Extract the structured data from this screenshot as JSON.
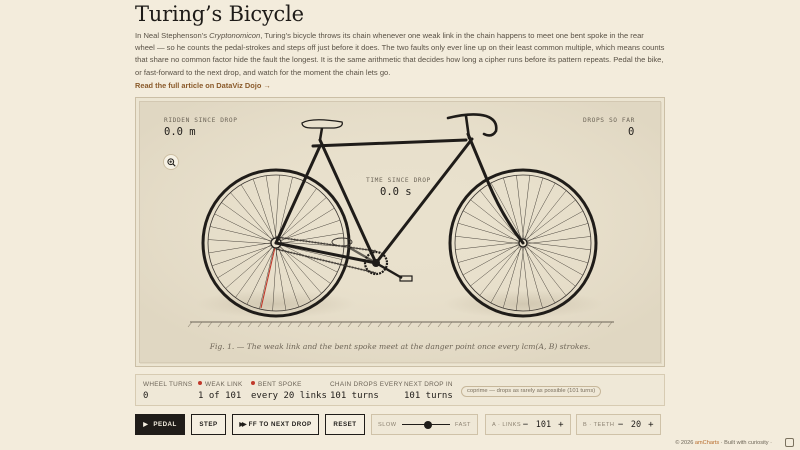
{
  "page": {
    "title": "Turing’s Bicycle",
    "intro_pre": "In Neal Stephenson’s ",
    "intro_em": "Cryptonomicon",
    "intro_post": ", Turing’s bicycle throws its chain whenever one weak link in the chain happens to meet one bent spoke in the rear wheel — so he counts the pedal-strokes and steps off just before it does. The two faults only ever line up on their least common multiple, which means counts that share no common factor hide the fault the longest. It is the same arithmetic that decides how long a cipher runs before its pattern repeats. Pedal the bike, or fast-forward to the next drop, and watch for the moment the chain lets go.",
    "read_more": "Read the full article on DataViz Dojo →"
  },
  "figure": {
    "ridden_label": "RIDDEN SINCE DROP",
    "ridden_value": "0.0 m",
    "drops_label": "DROPS SO FAR",
    "drops_value": "0",
    "time_label": "TIME SINCE DROP",
    "time_value": "0.0 s",
    "zoom_icon": "zoom-in-icon",
    "caption": "Fig. 1. — The weak link and the bent spoke meet at the danger point once every lcm(A, B) strokes.",
    "colors": {
      "frame": "#1f1c19",
      "bent_spoke": "#c0392b",
      "chain": "#3a3530"
    }
  },
  "stats": {
    "wheel_turns_label": "WHEEL TURNS",
    "wheel_turns_value": "0",
    "weak_link_label": "WEAK LINK",
    "weak_link_value": "1 of 101",
    "bent_spoke_label": "BENT SPOKE",
    "bent_spoke_value": "every 20 links",
    "chain_drops_label": "CHAIN DROPS EVERY",
    "chain_drops_value": "101 turns",
    "next_drop_label": "NEXT DROP IN",
    "next_drop_value": "101 turns",
    "badge": "coprime — drops as rarely as possible (101 turns)"
  },
  "controls": {
    "pedal": "PEDAL",
    "step": "STEP",
    "ff": "FF TO NEXT DROP",
    "reset": "RESET",
    "slow": "SLOW",
    "fast": "FAST",
    "speed": 0.55,
    "links_label": "A · LINKS",
    "links_value": "101",
    "teeth_label": "B · TEETH",
    "teeth_value": "20",
    "minus": "−",
    "plus": "+"
  },
  "footer": {
    "credit_pre": "© 2026 ",
    "credit_brand": "amCharts",
    "credit_post": " · Built with curiosity ·"
  }
}
